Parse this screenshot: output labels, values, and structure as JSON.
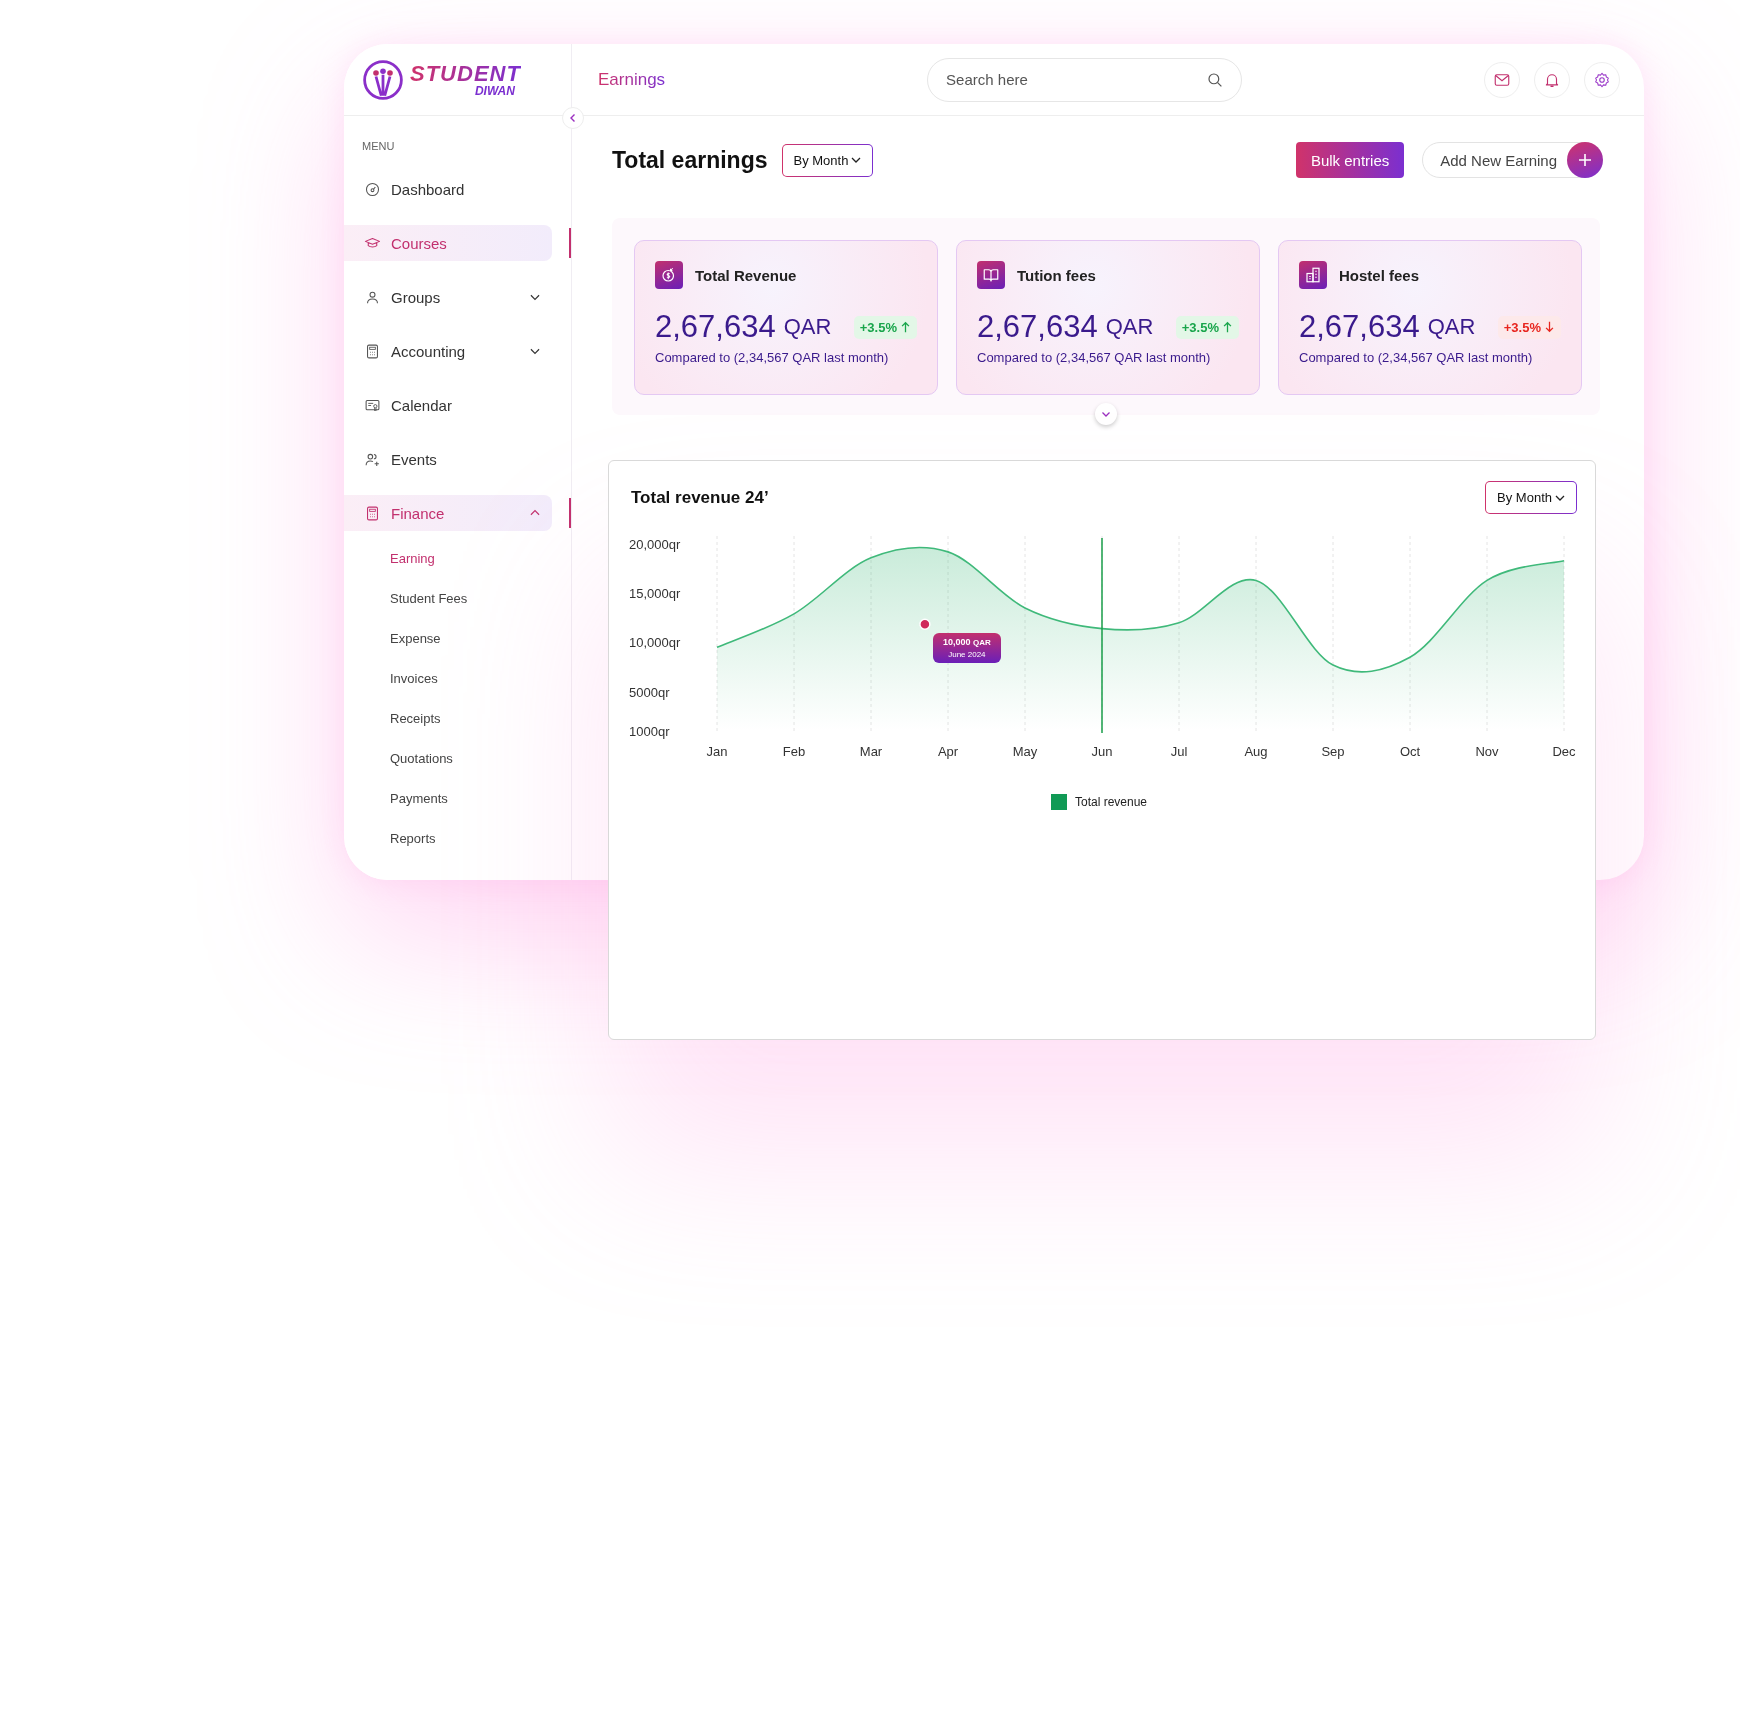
{
  "brand": {
    "name": "STUDENT",
    "subname": "DIWAN"
  },
  "sidebar": {
    "heading": "MENU",
    "items": [
      {
        "label": "Dashboard",
        "kind": "link",
        "selected": false
      },
      {
        "label": "Courses",
        "kind": "link",
        "selected": true
      },
      {
        "label": "Groups",
        "kind": "group",
        "selected": false,
        "expanded": false
      },
      {
        "label": "Accounting",
        "kind": "group",
        "selected": false,
        "expanded": false
      },
      {
        "label": "Calendar",
        "kind": "link",
        "selected": false
      },
      {
        "label": "Events",
        "kind": "link",
        "selected": false
      },
      {
        "label": "Finance",
        "kind": "group",
        "selected": true,
        "expanded": true,
        "children": [
          {
            "label": "Earning",
            "selected": true
          },
          {
            "label": "Student Fees",
            "selected": false
          },
          {
            "label": "Expense",
            "selected": false
          },
          {
            "label": "Invoices",
            "selected": false
          },
          {
            "label": "Receipts",
            "selected": false
          },
          {
            "label": "Quotations",
            "selected": false
          },
          {
            "label": "Payments",
            "selected": false
          },
          {
            "label": "Reports",
            "selected": false
          }
        ]
      }
    ]
  },
  "header": {
    "page_title": "Earnings",
    "search": {
      "placeholder": "Search here"
    }
  },
  "toolbar": {
    "title": "Total earnings",
    "period": "By Month",
    "buttons": [
      {
        "label": "Bulk entries",
        "kind": "primary"
      },
      {
        "label": "Add New Earning",
        "kind": "add"
      }
    ]
  },
  "cards": [
    {
      "title": "Total Revenue",
      "amount": "2,67,634",
      "unit": "QAR",
      "change": "+3.5%",
      "trend_up": true,
      "comparison": "Compared to (2,34,567 QAR last month)"
    },
    {
      "title": "Tution fees",
      "amount": "2,67,634",
      "unit": "QAR",
      "change": "+3.5%",
      "trend_up": true,
      "comparison": "Compared to (2,34,567 QAR last month)"
    },
    {
      "title": "Hostel fees",
      "amount": "2,67,634",
      "unit": "QAR",
      "change": "+3.5%",
      "trend_up": false,
      "comparison": "Compared to (2,34,567 QAR last month)"
    }
  ],
  "revenue_chart": {
    "title": "Total revenue 24’",
    "period": "By Month",
    "tooltip": {
      "value": "10,000",
      "unit": "QAR",
      "date": "June 2024"
    },
    "chart_data": {
      "type": "area",
      "categories": [
        "Jan",
        "Feb",
        "Mar",
        "Apr",
        "May",
        "Jun",
        "Jul",
        "Aug",
        "Sep",
        "Oct",
        "Nov",
        "Dec"
      ],
      "series": [
        {
          "name": "Total revenue",
          "color": "#3fb97a",
          "values": [
            9500,
            12900,
            18600,
            19200,
            13500,
            11400,
            12000,
            16300,
            7700,
            8500,
            16300,
            18300
          ]
        }
      ],
      "ylim": [
        1000,
        20000
      ],
      "grid": true,
      "yticks": [
        {
          "value": 1000,
          "label": "1000qr"
        },
        {
          "value": 5000,
          "label": "5000qr"
        },
        {
          "value": 10000,
          "label": "10,000qr"
        },
        {
          "value": 15000,
          "label": "15,000qr"
        },
        {
          "value": 20000,
          "label": "20,000qr"
        }
      ],
      "ref_lines": [
        {
          "axis": "x",
          "value": "Jun"
        }
      ]
    }
  }
}
